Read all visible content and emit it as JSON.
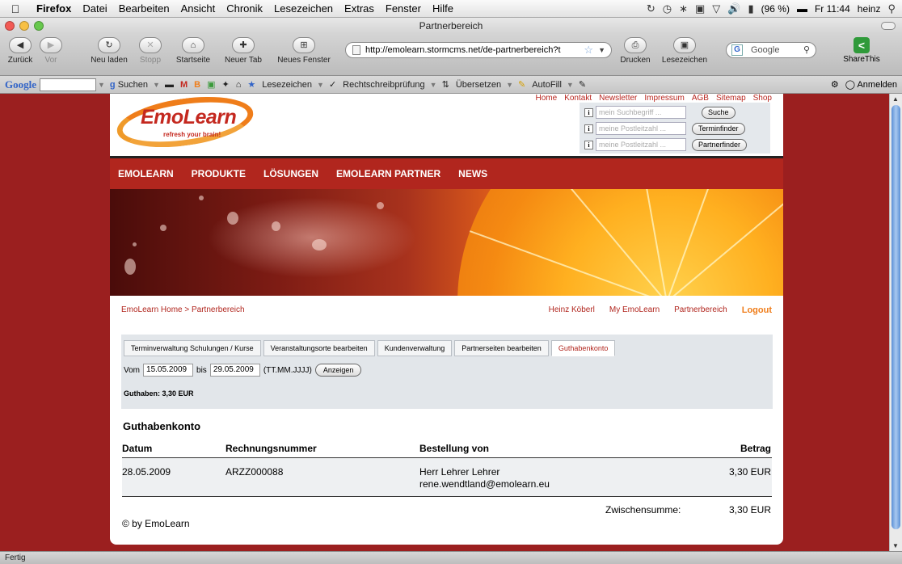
{
  "menubar": {
    "app": "Firefox",
    "items": [
      "Datei",
      "Bearbeiten",
      "Ansicht",
      "Chronik",
      "Lesezeichen",
      "Extras",
      "Fenster",
      "Hilfe"
    ],
    "battery": "(96 %)",
    "clock": "Fr 11:44",
    "user": "heinz"
  },
  "window": {
    "title": "Partnerbereich"
  },
  "toolbar": {
    "back": "Zurück",
    "forward": "Vor",
    "reload": "Neu laden",
    "stop": "Stopp",
    "home": "Startseite",
    "new_tab": "Neuer Tab",
    "new_window": "Neues Fenster",
    "url": "http://emolearn.stormcms.net/de-partnerbereich?t",
    "print": "Drucken",
    "bookmarks": "Lesezeichen",
    "search_placeholder": "Google",
    "share": "ShareThis"
  },
  "google_toolbar": {
    "logo": "Google",
    "search": "Suchen",
    "bookmarks": "Lesezeichen",
    "spellcheck": "Rechtschreibprüfung",
    "translate": "Übersetzen",
    "autofill": "AutoFill",
    "signin": "Anmelden"
  },
  "site": {
    "top_links": [
      "Home",
      "Kontakt",
      "Newsletter",
      "Impressum",
      "AGB",
      "Sitemap",
      "Shop"
    ],
    "logo_text": "EmoLearn",
    "logo_tagline": "refresh your brain!",
    "search_rows": [
      {
        "placeholder": "mein Suchbegriff ...",
        "button": "Suche"
      },
      {
        "placeholder": "meine Postleitzahl ...",
        "button": "Terminfinder"
      },
      {
        "placeholder": "meine Postleitzahl ...",
        "button": "Partnerfinder"
      }
    ],
    "nav": [
      "EMOLEARN",
      "PRODUKTE",
      "LÖSUNGEN",
      "EMOLEARN PARTNER",
      "NEWS"
    ],
    "breadcrumb": "EmoLearn Home > Partnerbereich",
    "user_links": [
      "Heinz Köberl",
      "My EmoLearn",
      "Partnerbereich"
    ],
    "logout": "Logout"
  },
  "partner": {
    "tabs": [
      "Terminverwaltung Schulungen / Kurse",
      "Veranstaltungsorte bearbeiten",
      "Kundenverwaltung",
      "Partnerseiten bearbeiten",
      "Guthabenkonto"
    ],
    "active_tab": 4,
    "from_label": "Vom",
    "from": "15.05.2009",
    "to_label": "bis",
    "to": "29.05.2009",
    "format": "(TT.MM.JJJJ)",
    "show_button": "Anzeigen",
    "balance": "Guthaben: 3,30 EUR"
  },
  "ledger": {
    "title": "Guthabenkonto",
    "columns": [
      "Datum",
      "Rechnungsnummer",
      "Bestellung von",
      "Betrag"
    ],
    "rows": [
      {
        "date": "28.05.2009",
        "invoice": "ARZZ000088",
        "name": "Herr Lehrer Lehrer",
        "email": "rene.wendtland@emolearn.eu",
        "amount": "3,30 EUR"
      }
    ],
    "subtotal_label": "Zwischensumme:",
    "subtotal": "3,30 EUR"
  },
  "footer": {
    "copyright": "© by EmoLearn"
  },
  "status": "Fertig"
}
